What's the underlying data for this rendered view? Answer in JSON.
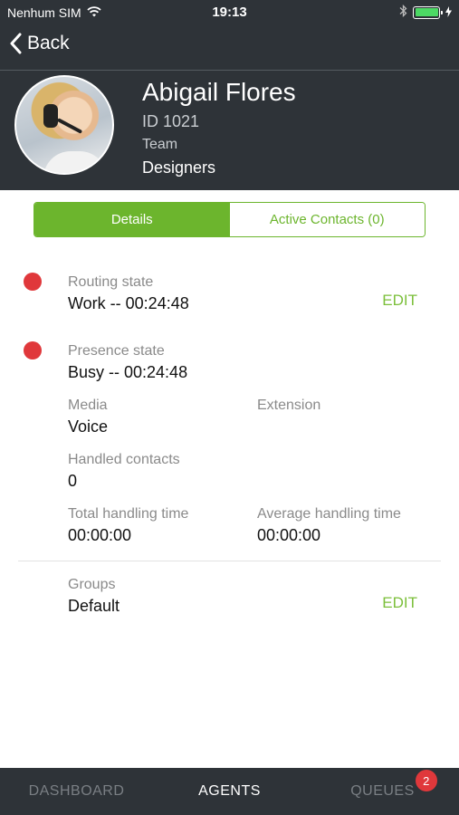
{
  "status_bar": {
    "carrier": "Nenhum SIM",
    "time": "19:13",
    "wifi_icon": "wifi-icon",
    "bluetooth_icon": "bluetooth-icon",
    "battery_level": 1.0
  },
  "nav": {
    "back_label": "Back"
  },
  "profile": {
    "name": "Abigail Flores",
    "id": "ID 1021",
    "team_label": "Team",
    "team": "Designers"
  },
  "tabs": {
    "details": "Details",
    "active_contacts": "Active Contacts (0)"
  },
  "details": {
    "routing_label": "Routing state",
    "routing_value": "Work -- 00:24:48",
    "routing_edit": "EDIT",
    "presence_label": "Presence state",
    "presence_value": "Busy -- 00:24:48",
    "media_label": "Media",
    "media_value": "Voice",
    "extension_label": "Extension",
    "extension_value": "",
    "handled_label": "Handled contacts",
    "handled_value": "0",
    "total_label": "Total handling time",
    "total_value": "00:00:00",
    "avg_label": "Average handling time",
    "avg_value": "00:00:00",
    "groups_label": "Groups",
    "groups_value": "Default",
    "groups_edit": "EDIT"
  },
  "tabbar": {
    "dashboard": "DASHBOARD",
    "agents": "AGENTS",
    "queues": "QUEUES",
    "queues_badge": "2"
  },
  "colors": {
    "accent": "#6cb52d",
    "status_red": "#e0383b",
    "dark": "#2e3338"
  }
}
